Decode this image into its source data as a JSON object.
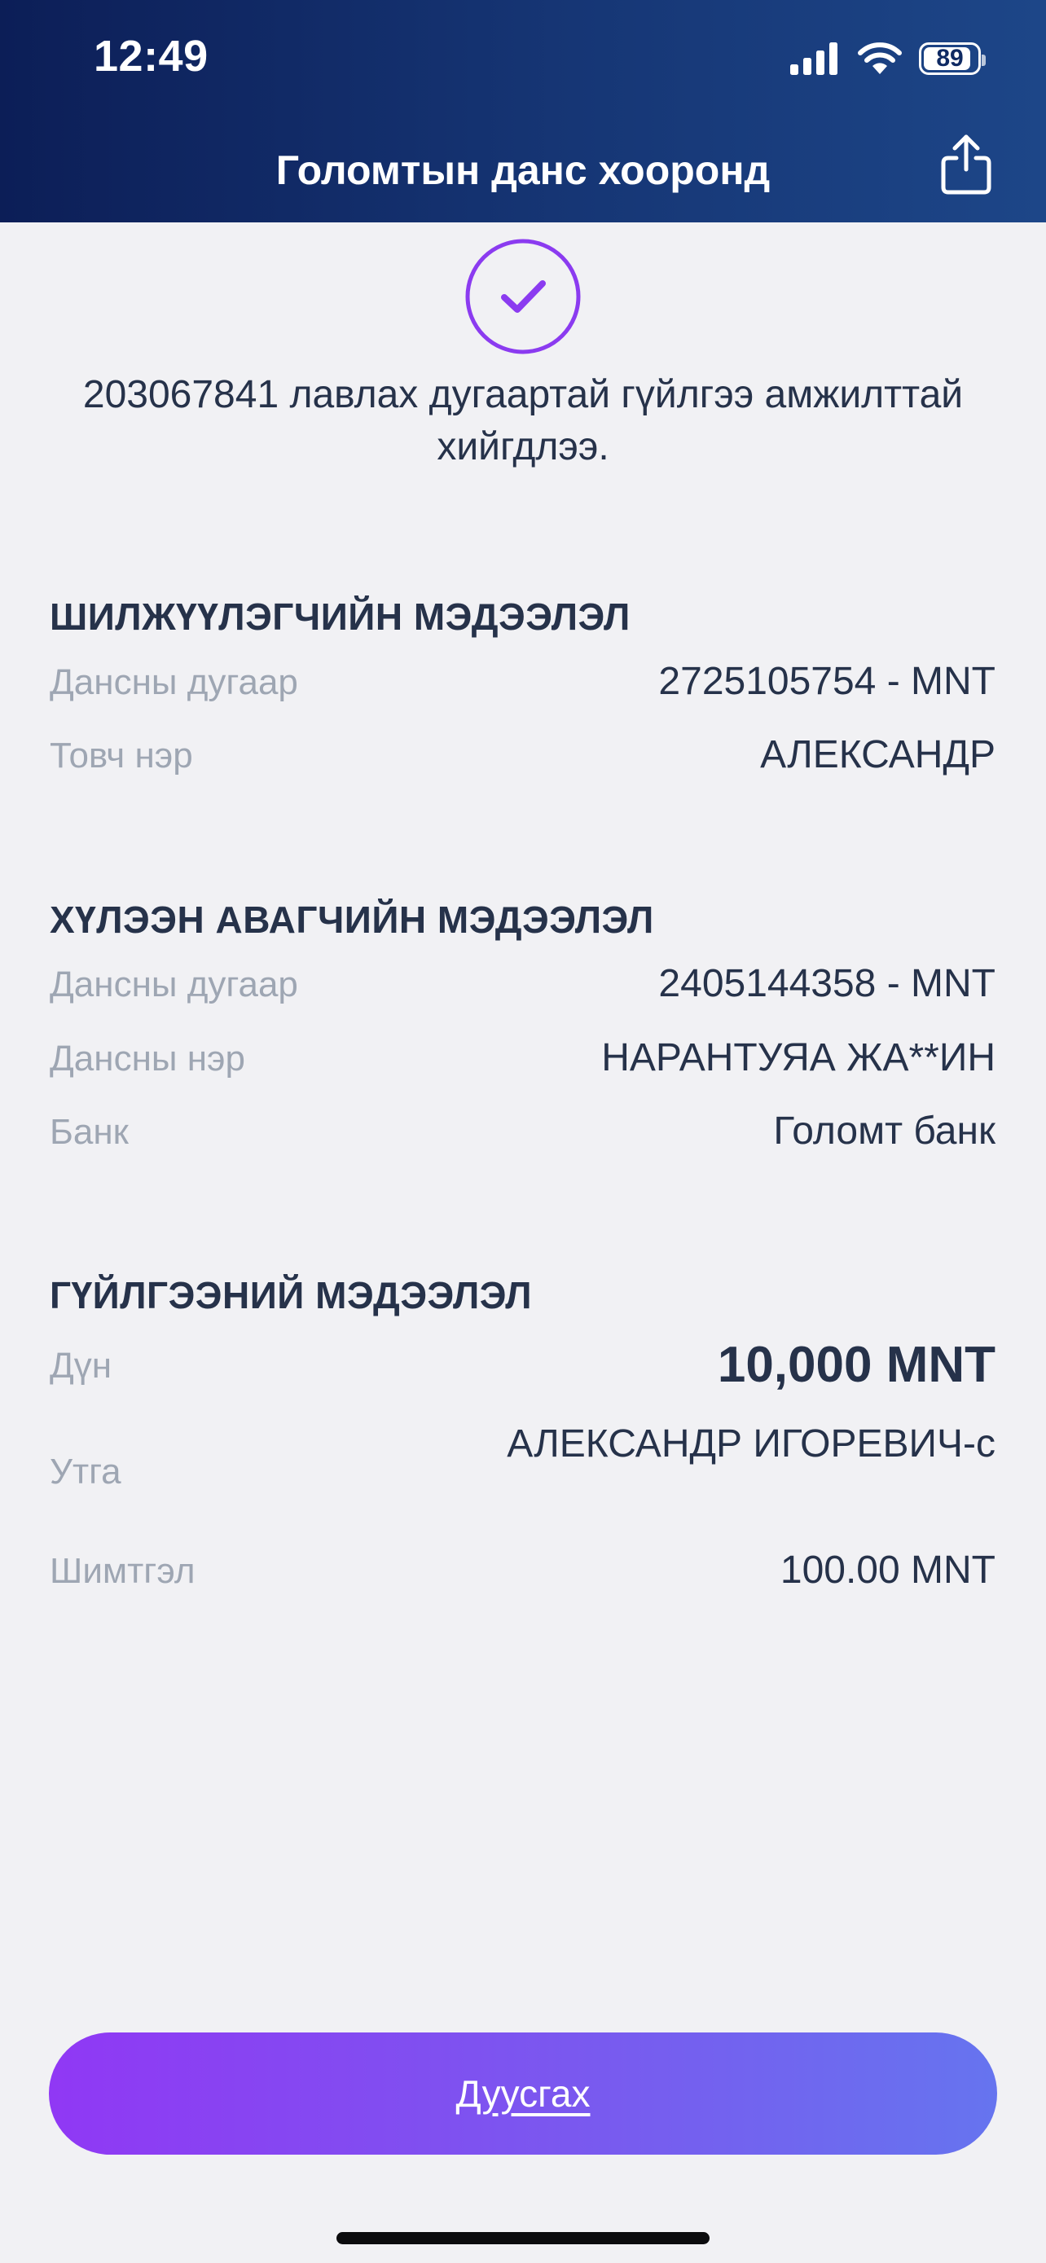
{
  "status_bar": {
    "time": "12:49",
    "battery": "89",
    "battery_level": 0.89
  },
  "header": {
    "title": "Голомтын данс хооронд",
    "share_icon": "share-icon"
  },
  "success": {
    "icon": "check-circle-icon",
    "message": "203067841 лавлах дугаартай гүйлгээ амжилттай хийгдлээ."
  },
  "sender": {
    "title": "ШИЛЖҮҮЛЭГЧИЙН МЭДЭЭЛЭЛ",
    "rows": [
      {
        "label": "Дансны дугаар",
        "value": "2725105754 - MNT"
      },
      {
        "label": "Товч нэр",
        "value": "АЛЕКСАНДР"
      }
    ]
  },
  "receiver": {
    "title": "ХҮЛЭЭН АВАГЧИЙН МЭДЭЭЛЭЛ",
    "rows": [
      {
        "label": "Дансны дугаар",
        "value": "2405144358 - MNT"
      },
      {
        "label": "Дансны нэр",
        "value": "НАРАНТУЯА ЖА**ИН"
      },
      {
        "label": "Банк",
        "value": "Голомт банк"
      }
    ]
  },
  "transaction": {
    "title": "ГҮЙЛГЭЭНИЙ МЭДЭЭЛЭЛ",
    "rows": [
      {
        "label": "Дүн",
        "value": "10,000 MNT"
      },
      {
        "label": "Утга",
        "value": "АЛЕКСАНДР ИГОРЕВИЧ-с"
      },
      {
        "label": "Шимтгэл",
        "value": "100.00 MNT"
      }
    ]
  },
  "footer": {
    "done_label": "Дуусгах"
  },
  "colors": {
    "header_gradient": [
      "#0c1e57",
      "#1d4688"
    ],
    "accent": "#8b3bf0",
    "button_gradient": [
      "#9038f4",
      "#6674ef"
    ],
    "background": "#f1f1f4",
    "label": "#9ea6b3",
    "text": "#26324a"
  }
}
